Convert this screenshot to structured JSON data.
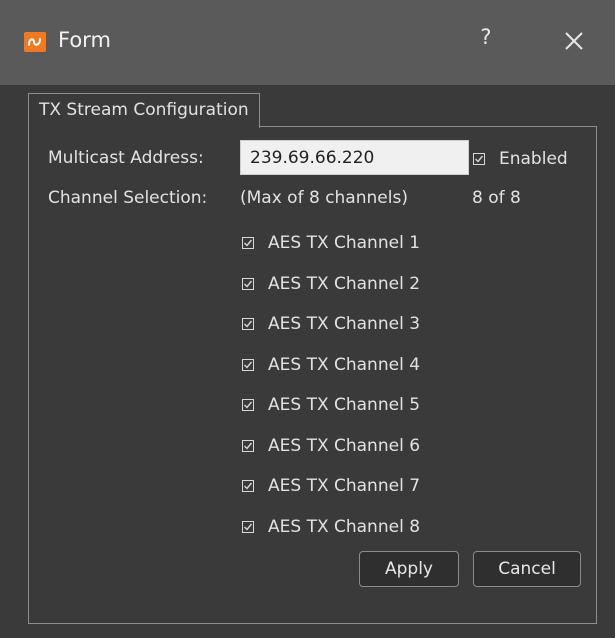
{
  "window": {
    "title": "Form",
    "help_label": "?"
  },
  "group": {
    "title": "TX Stream Configuration"
  },
  "multicast": {
    "label": "Multicast Address:",
    "value": "239.69.66.220",
    "enabled_label": "Enabled",
    "enabled_checked": true
  },
  "channel_selection": {
    "label": "Channel Selection:",
    "hint": "(Max of 8 channels)",
    "count": "8 of 8",
    "channels": [
      {
        "label": "AES TX Channel 1",
        "checked": true
      },
      {
        "label": "AES TX Channel 2",
        "checked": true
      },
      {
        "label": "AES TX Channel 3",
        "checked": true
      },
      {
        "label": "AES TX Channel 4",
        "checked": true
      },
      {
        "label": "AES TX Channel 5",
        "checked": true
      },
      {
        "label": "AES TX Channel 6",
        "checked": true
      },
      {
        "label": "AES TX Channel 7",
        "checked": true
      },
      {
        "label": "AES TX Channel 8",
        "checked": true
      }
    ]
  },
  "buttons": {
    "apply_label": "Apply",
    "cancel_label": "Cancel"
  },
  "colors": {
    "titlebar": "#5a5a5a",
    "background": "#3a3a3a",
    "accent_icon": "#f07a22"
  }
}
